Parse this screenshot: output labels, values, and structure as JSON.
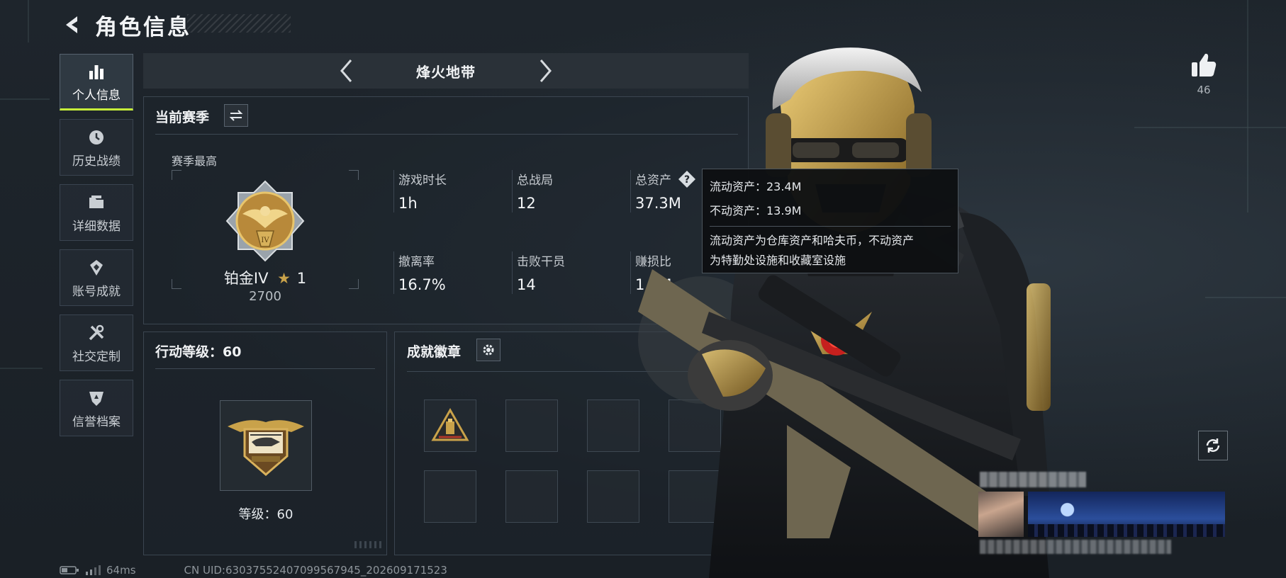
{
  "header": {
    "title": "角色信息"
  },
  "sidebar": {
    "items": [
      {
        "label": "个人信息",
        "icon": "bar-chart-icon"
      },
      {
        "label": "历史战绩",
        "icon": "clock-icon"
      },
      {
        "label": "详细数据",
        "icon": "folder-icon"
      },
      {
        "label": "账号成就",
        "icon": "achievement-icon"
      },
      {
        "label": "社交定制",
        "icon": "tools-icon"
      },
      {
        "label": "信誉档案",
        "icon": "shield-icon"
      }
    ],
    "active_index": 0
  },
  "mode": {
    "name": "烽火地带"
  },
  "season": {
    "title": "当前赛季",
    "best_label": "赛季最高",
    "rank_name": "铂金IV",
    "rank_stars": "1",
    "rank_score": "2700",
    "stats": [
      {
        "label": "游戏时长",
        "value": "1h"
      },
      {
        "label": "总战局",
        "value": "12"
      },
      {
        "label": "总资产",
        "value": "37.3M"
      },
      {
        "label": "撤离率",
        "value": "16.7%"
      },
      {
        "label": "击败干员",
        "value": "14"
      },
      {
        "label": "赚损比",
        "value": "1.3M"
      }
    ]
  },
  "tooltip": {
    "liquid": "流动资产：23.4M",
    "fixed": "不动资产：13.9M",
    "desc_line1": "流动资产为仓库资产和哈夫币，不动资产",
    "desc_line2": "为特勤处设施和收藏室设施"
  },
  "action_level": {
    "title": "行动等级：60",
    "level_text": "等级：60"
  },
  "badges": {
    "title": "成就徽章",
    "slots": 8,
    "filled_slots": 1
  },
  "likes": {
    "count": "46"
  },
  "footer": {
    "ping": "64ms",
    "uid": "CN UID:6303755240709956794​5_202609171523"
  },
  "colors": {
    "accent": "#c7f03a",
    "gold": "#c9a24a",
    "panel_border": "#3b4550"
  }
}
